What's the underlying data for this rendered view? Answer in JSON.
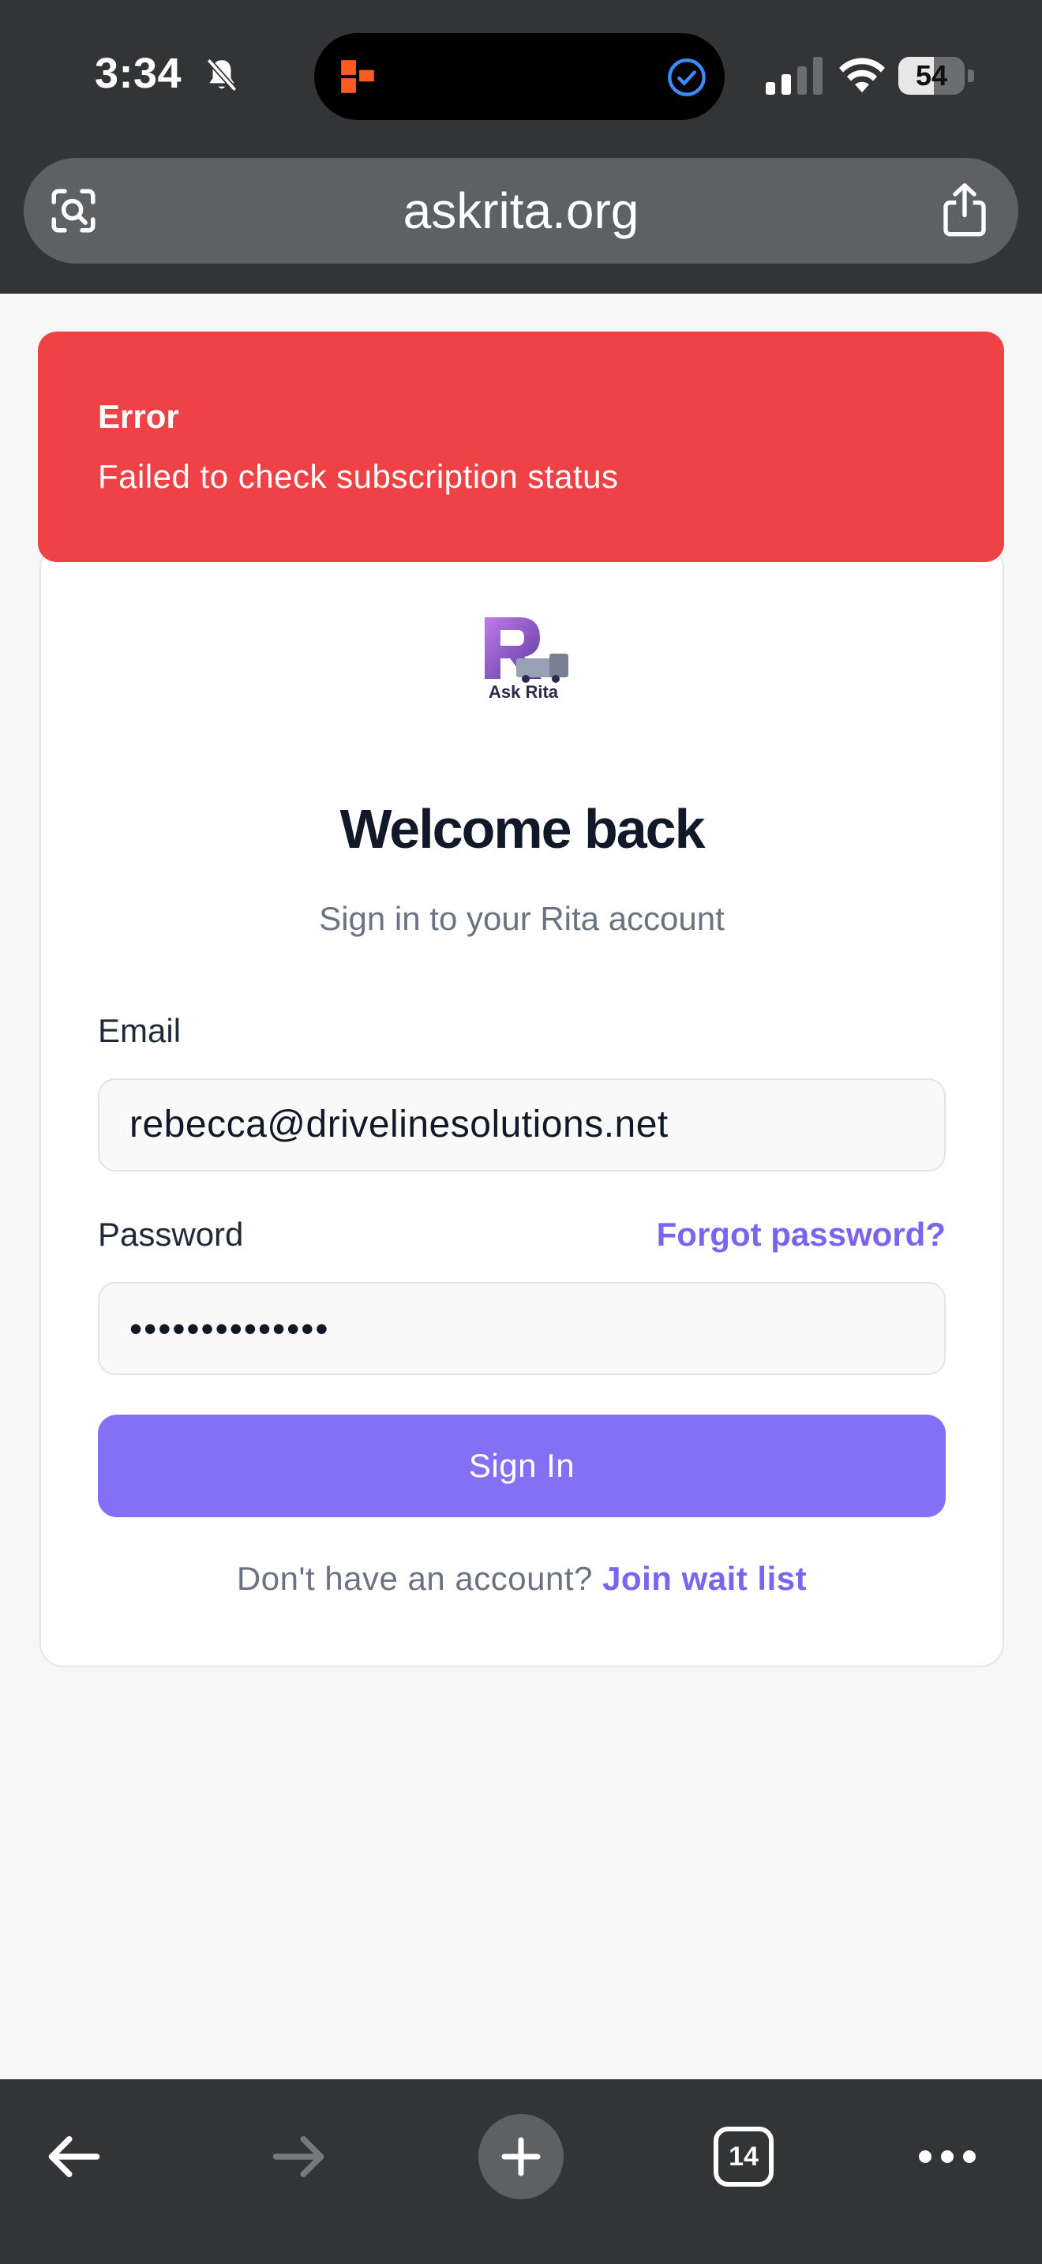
{
  "status_bar": {
    "time": "3:34",
    "battery_level": "54",
    "battery_fraction": 0.54,
    "icons": [
      "bell-slash-icon",
      "orange-app-icon",
      "check-circle-icon",
      "cellular-icon",
      "wifi-icon",
      "battery-icon"
    ]
  },
  "browser": {
    "url": "askrita.org",
    "icons": [
      "lens-icon",
      "share-icon"
    ]
  },
  "error": {
    "title": "Error",
    "message": "Failed to check subscription status",
    "color": "#ef4246"
  },
  "login": {
    "logo_text": "Ask Rita",
    "heading": "Welcome back",
    "subtitle": "Sign in to your Rita account",
    "email_label": "Email",
    "email_value": "rebecca@drivelinesolutions.net",
    "password_label": "Password",
    "password_value": "••••••••••••••",
    "forgot_label": "Forgot password?",
    "signin_label": "Sign In",
    "no_account_text": "Don't have an account?",
    "join_label": "Join wait list",
    "accent_color": "#8470f5"
  },
  "toolbar": {
    "tab_count": "14",
    "icons": [
      "back-arrow-icon",
      "forward-arrow-icon",
      "plus-icon",
      "tabs-icon",
      "more-icon"
    ]
  }
}
